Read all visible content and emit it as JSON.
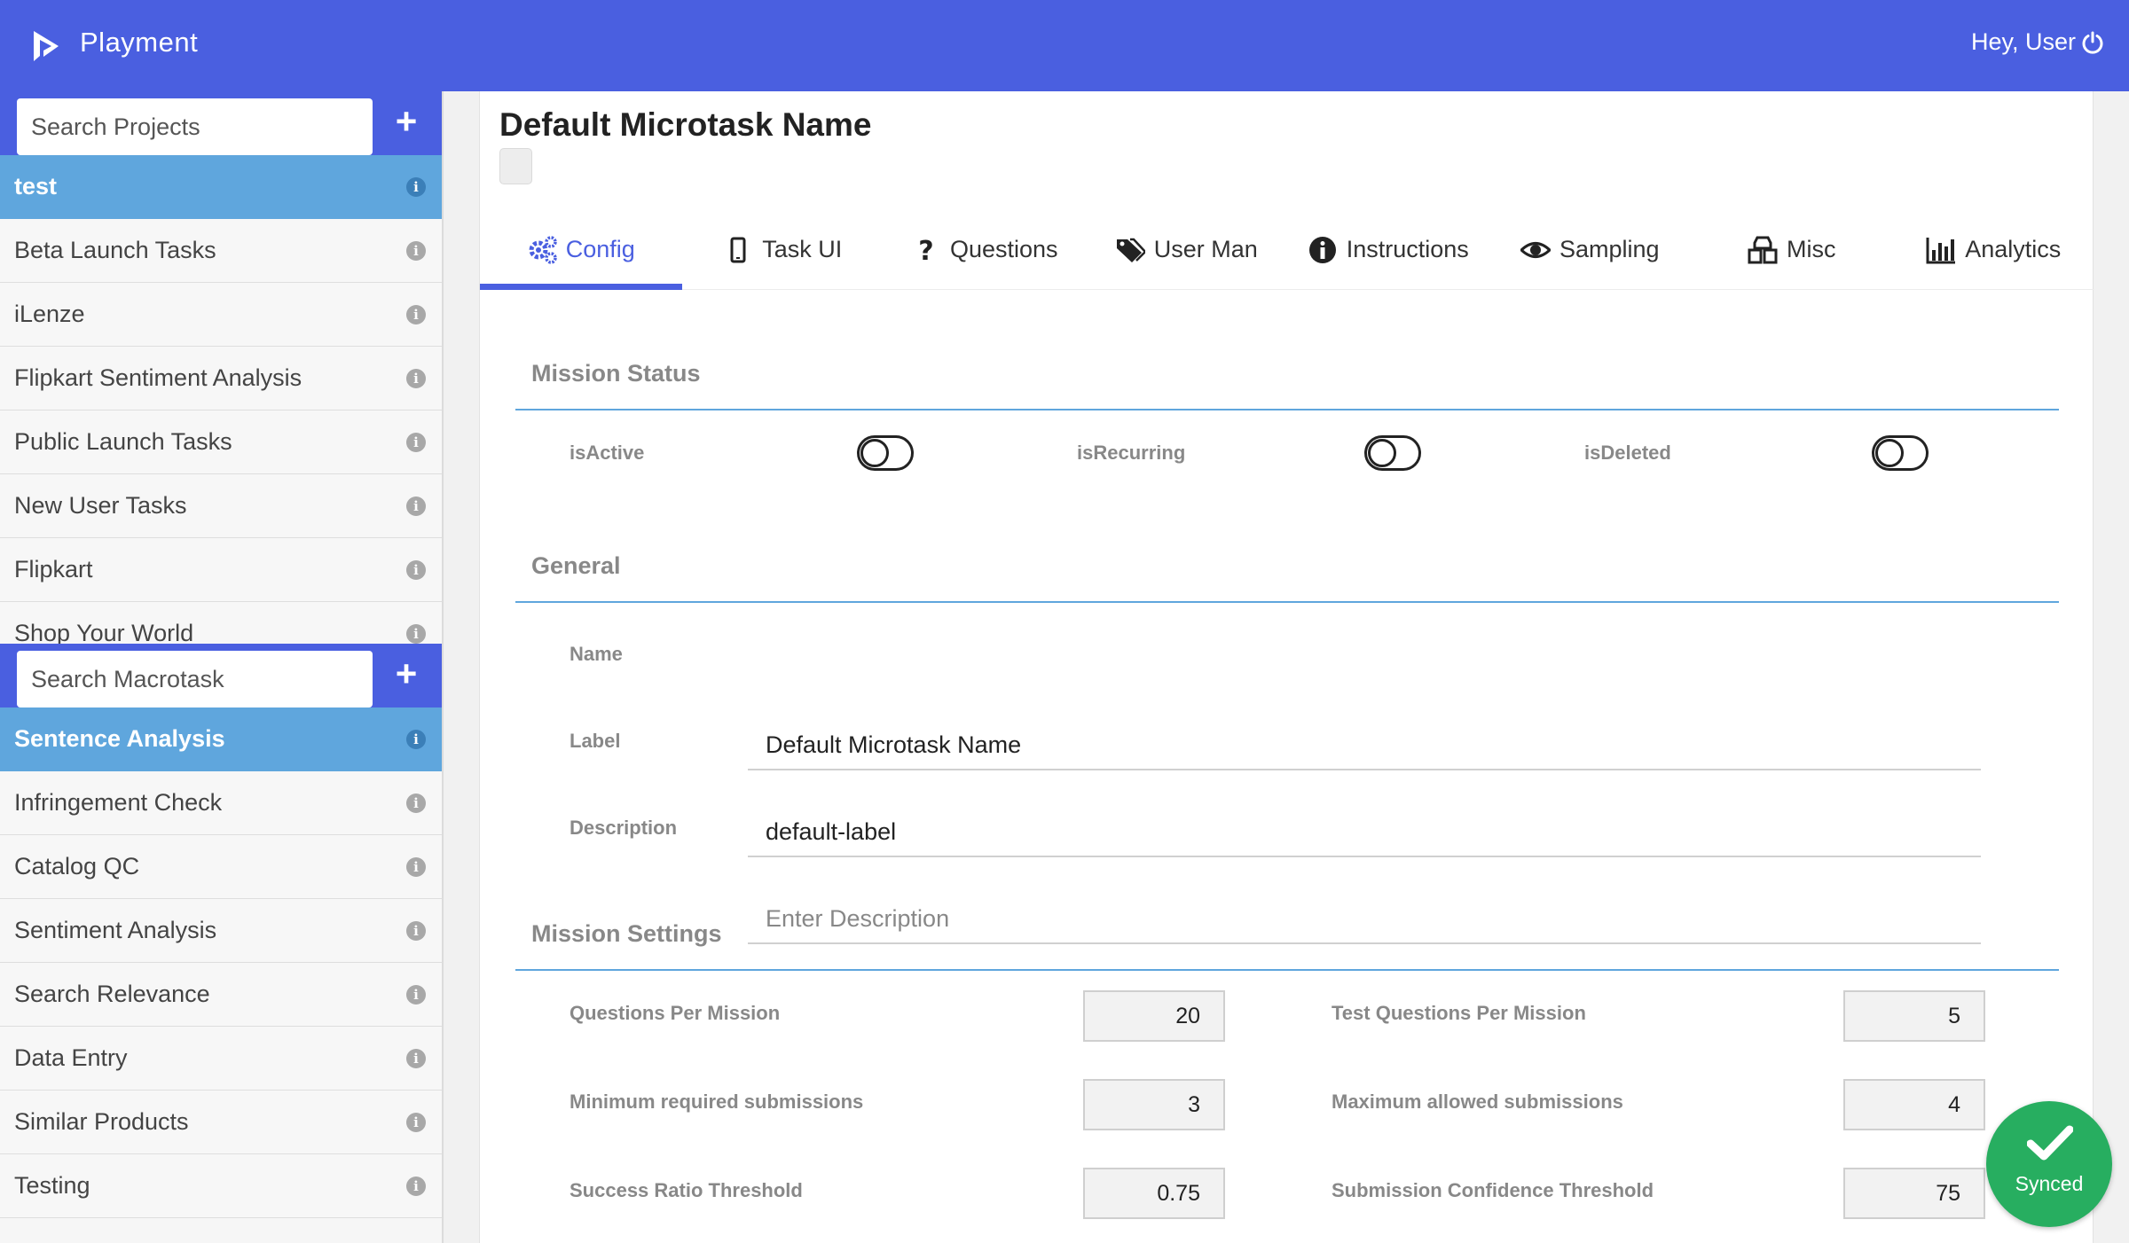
{
  "header": {
    "brand": "Playment",
    "greeting": "Hey, User",
    "colors": {
      "primary": "#4a5fe0",
      "active_item": "#5fa6dd",
      "success": "#27ae60"
    }
  },
  "sidebar": {
    "projects_search_placeholder": "Search Projects",
    "projects": [
      {
        "label": "test",
        "active": true
      },
      {
        "label": "Beta Launch Tasks"
      },
      {
        "label": "iLenze"
      },
      {
        "label": "Flipkart Sentiment Analysis"
      },
      {
        "label": "Public Launch Tasks"
      },
      {
        "label": "New User Tasks"
      },
      {
        "label": "Flipkart"
      },
      {
        "label": "Shop Your World"
      }
    ],
    "macrotask_search_placeholder": "Search Macrotask",
    "macrotasks": [
      {
        "label": "Sentence Analysis",
        "active": true
      },
      {
        "label": "Infringement Check"
      },
      {
        "label": "Catalog QC"
      },
      {
        "label": "Sentiment Analysis"
      },
      {
        "label": "Search Relevance"
      },
      {
        "label": "Data Entry"
      },
      {
        "label": "Similar Products"
      },
      {
        "label": "Testing"
      }
    ]
  },
  "main": {
    "title": "Default Microtask Name",
    "tabs": [
      {
        "label": "Config",
        "icon": "gears-icon",
        "active": true
      },
      {
        "label": "Task UI",
        "icon": "mobile-icon"
      },
      {
        "label": "Questions",
        "icon": "question-icon"
      },
      {
        "label": "User Man",
        "icon": "tags-icon"
      },
      {
        "label": "Instructions",
        "icon": "info-circle-icon"
      },
      {
        "label": "Sampling",
        "icon": "eye-icon"
      },
      {
        "label": "Misc",
        "icon": "cubes-icon"
      },
      {
        "label": "Analytics",
        "icon": "bar-chart-icon"
      }
    ],
    "mission_status": {
      "title": "Mission Status",
      "toggles": [
        {
          "label": "isActive",
          "on": false
        },
        {
          "label": "isRecurring",
          "on": false
        },
        {
          "label": "isDeleted",
          "on": false
        }
      ]
    },
    "general": {
      "title": "General",
      "name_label": "Name",
      "name_value": "Default Microtask Name",
      "label_label": "Label",
      "label_value": "default-label",
      "description_label": "Description",
      "description_placeholder": "Enter Description"
    },
    "mission_settings": {
      "title": "Mission Settings",
      "fields": [
        {
          "label": "Questions Per Mission",
          "value": "20"
        },
        {
          "label": "Test Questions Per Mission",
          "value": "5"
        },
        {
          "label": "Minimum required submissions",
          "value": "3"
        },
        {
          "label": "Maximum allowed submissions",
          "value": "4"
        },
        {
          "label": "Success Ratio Threshold",
          "value": "0.75"
        },
        {
          "label": "Submission Confidence Threshold",
          "value": "75"
        }
      ]
    }
  },
  "sync": {
    "label": "Synced"
  }
}
